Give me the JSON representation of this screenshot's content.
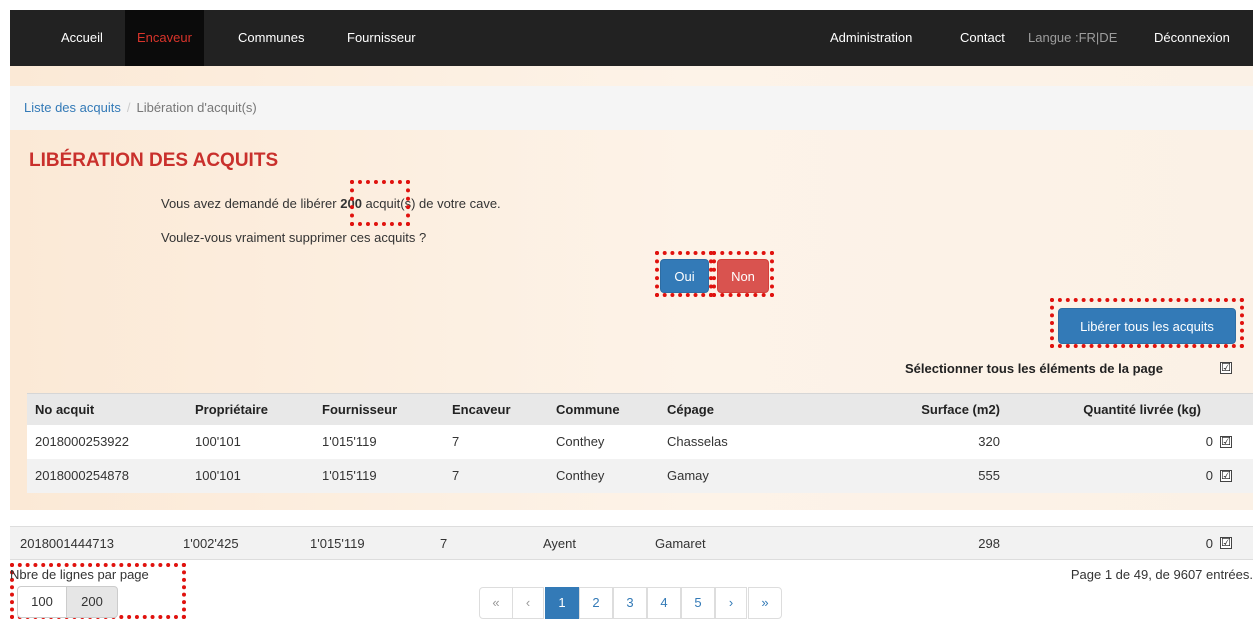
{
  "nav": {
    "left": [
      "Accueil",
      "Encaveur",
      "Communes",
      "Fournisseur"
    ],
    "right": {
      "admin": "Administration",
      "contact": "Contact",
      "langue": "Langue :FR|DE",
      "logout": "Déconnexion"
    }
  },
  "breadcrumb": {
    "link": "Liste des acquits",
    "separator": "/",
    "current": "Libération d'acquit(s)"
  },
  "title": "LIBÉRATION DES ACQUITS",
  "message": {
    "before": "Vous avez demandé de libérer ",
    "count": "200",
    "after": " acquit(s) de votre cave.",
    "question": "Voulez-vous vraiment supprimer ces acquits ?"
  },
  "buttons": {
    "oui": "Oui",
    "non": "Non",
    "liberer_tous": "Libérer tous les acquits"
  },
  "select_all": {
    "label": "Sélectionner tous les éléments de la page",
    "checked": true,
    "mark": "☑"
  },
  "table": {
    "headers": [
      "No acquit",
      "Propriétaire",
      "Fournisseur",
      "Encaveur",
      "Commune",
      "Cépage",
      "Surface (m2)",
      "Quantité livrée (kg)"
    ],
    "rows": [
      {
        "no": "2018000253922",
        "prop": "100'101",
        "four": "1'015'119",
        "enc": "7",
        "comm": "Conthey",
        "cep": "Chasselas",
        "surf": "320",
        "qte": "0",
        "checked": true
      },
      {
        "no": "2018000254878",
        "prop": "100'101",
        "four": "1'015'119",
        "enc": "7",
        "comm": "Conthey",
        "cep": "Gamay",
        "surf": "555",
        "qte": "0",
        "checked": true
      },
      {
        "no": "2018001444713",
        "prop": "1'002'425",
        "four": "1'015'119",
        "enc": "7",
        "comm": "Ayent",
        "cep": "Gamaret",
        "surf": "298",
        "qte": "0",
        "checked": true
      }
    ]
  },
  "footer": {
    "rows_label": "Nbre de lignes par page",
    "rows_options": [
      "100",
      "200"
    ],
    "selected_rows": "200",
    "page_info": "Page 1 de 49, de 9607 entrées.",
    "pagination": [
      "«",
      "‹",
      "1",
      "2",
      "3",
      "4",
      "5",
      "›",
      "»"
    ],
    "current_page": "1"
  },
  "colors": {
    "navbar": "#222222",
    "active_nav": "#d9342b",
    "title": "#c9302c",
    "primary": "#337ab7",
    "danger": "#d9534f",
    "highlight": "#e0120e"
  }
}
